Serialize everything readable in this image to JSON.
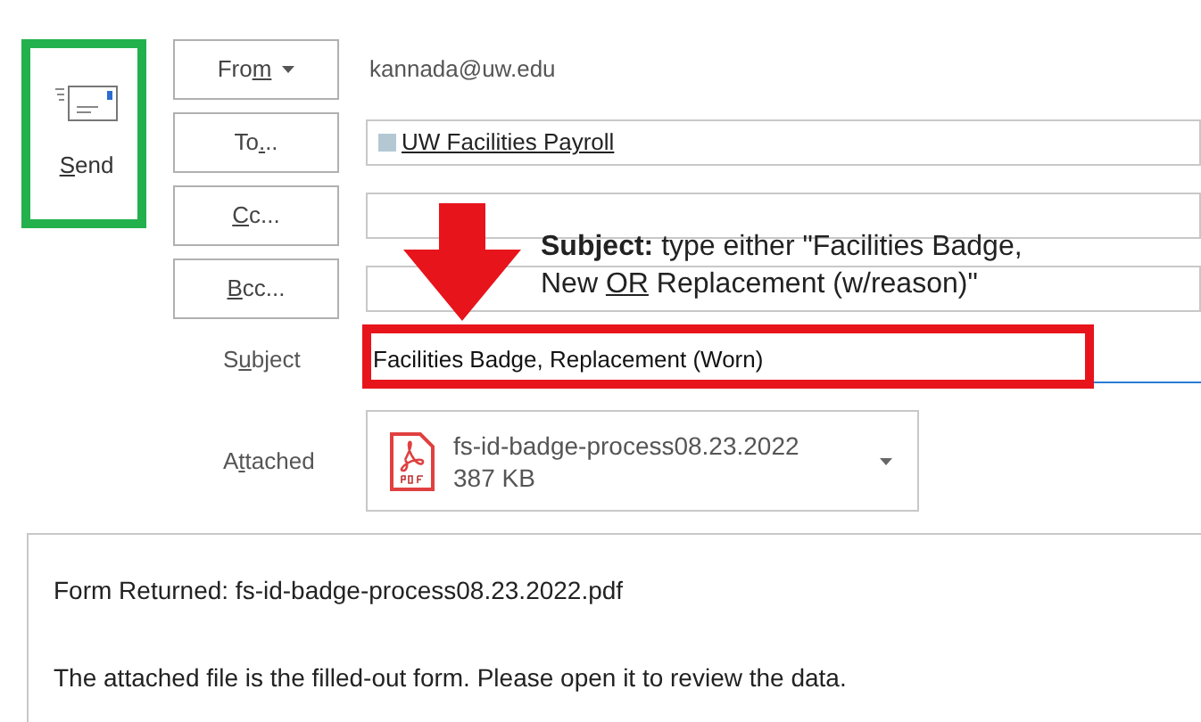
{
  "send_button": {
    "key": "S",
    "post": "end"
  },
  "address_rows": [
    {
      "kind": "from",
      "label": {
        "pre": "Fro",
        "key": "m"
      },
      "value": "kannada@uw.edu"
    },
    {
      "kind": "to",
      "label": {
        "pre": "To",
        "key": ".",
        "post": ".."
      },
      "recipient": "UW Facilities Payroll"
    },
    {
      "kind": "cc",
      "label": {
        "key": "C",
        "post": "c..."
      }
    },
    {
      "kind": "bcc",
      "label": {
        "key": "B",
        "post": "cc..."
      }
    }
  ],
  "subject": {
    "label": {
      "pre": "S",
      "key": "u",
      "post": "bject"
    },
    "value": "Facilities Badge, Replacement (Worn)"
  },
  "attached": {
    "label": {
      "pre": "A",
      "key": "t",
      "post": "tached"
    },
    "file_name": "fs-id-badge-process08.23.2022",
    "file_size": "387 KB"
  },
  "body": [
    "Form Returned: fs-id-badge-process08.23.2022.pdf",
    "The attached file is the filled-out form. Please open it to review the data."
  ],
  "annotation": {
    "line_1": "**Subject:** type either \"Facilities Badge,",
    "line_2": {
      "pre": "New ",
      "key": "OR",
      "post": " Replacement (w/reason)\""
    }
  }
}
